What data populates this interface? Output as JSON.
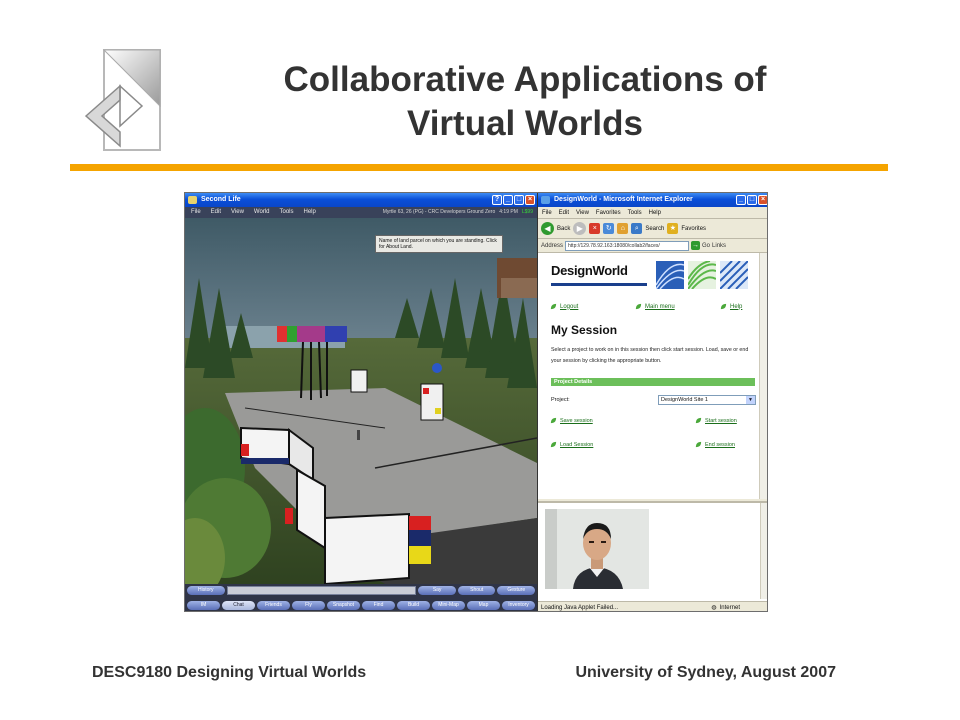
{
  "slide": {
    "title_line1": "Collaborative Applications of",
    "title_line2": "Virtual Worlds",
    "footer_left": "DESC9180 Designing Virtual Worlds",
    "footer_right": "University of Sydney, August 2007",
    "accent_color": "#f5a400"
  },
  "second_life": {
    "window_title": "Second Life",
    "menu": [
      "File",
      "Edit",
      "View",
      "World",
      "Tools",
      "Help"
    ],
    "location": "Myrtle 63, 26 (PG) - CRC Developers Ground Zero",
    "time": "4:19 PM",
    "balance": "L$99",
    "tooltip": "Name of land parcel on which you are standing. Click for About Land.",
    "chat_buttons": {
      "history": "History",
      "say": "Say",
      "shout": "Shout",
      "gesture": "Gesture"
    },
    "toolbar": [
      "IM",
      "Chat",
      "Friends",
      "Fly",
      "Snapshot",
      "Find",
      "Build",
      "Mini-Map",
      "Map",
      "Inventory"
    ]
  },
  "ie": {
    "window_title": "DesignWorld - Microsoft Internet Explorer",
    "menu": [
      "File",
      "Edit",
      "View",
      "Favorites",
      "Tools",
      "Help"
    ],
    "toolbar": {
      "back": "Back",
      "search": "Search",
      "favorites": "Favorites"
    },
    "address_label": "Address",
    "url": "http://129.78.92.163:18080/collab2/faces/",
    "go": "Go",
    "links": "Links",
    "status": "Loading Java Applet Failed...",
    "zone": "Internet"
  },
  "designworld": {
    "logo": "DesignWorld",
    "nav": {
      "logout": "Logout",
      "main_menu": "Main menu",
      "help": "Help"
    },
    "heading": "My Session",
    "description": "Select a project to work on in this session then click start session. Load, save or end your session by clicking the appropriate button.",
    "section": "Project Details",
    "project_label": "Project:",
    "project_selected": "DesignWorld Site 1",
    "actions": {
      "save": "Save session",
      "start": "Start session",
      "load": "Load Session",
      "end": "End session"
    }
  }
}
